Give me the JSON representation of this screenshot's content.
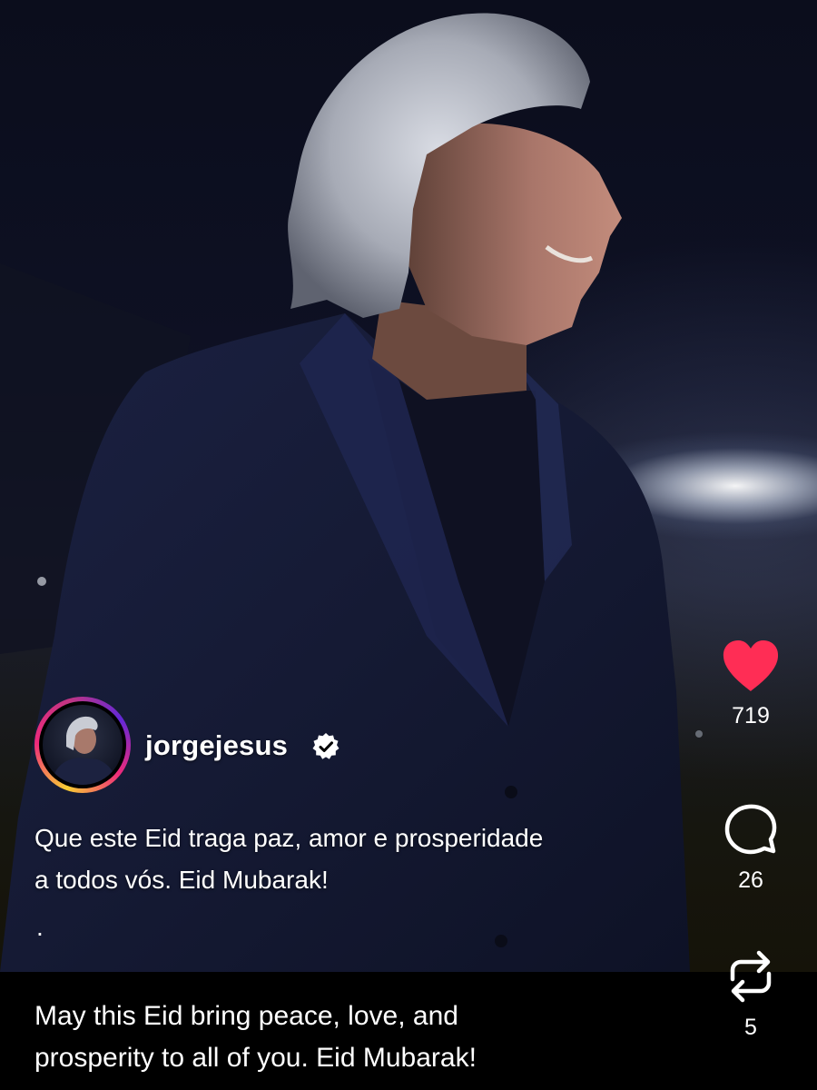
{
  "post": {
    "username": "jorgejesus",
    "caption_line1": "Que este Eid traga paz, amor e prosperidade",
    "caption_line2": "a todos vós. Eid Mubarak!",
    "caption_dot": ".",
    "translation_line1": "May this Eid bring peace, love, and",
    "translation_line2": "prosperity to all of you. Eid Mubarak!"
  },
  "actions": {
    "likes": "719",
    "comments": "26",
    "reposts": "5"
  },
  "colors": {
    "like": "#ff2d55",
    "background": "#000000",
    "text": "#ffffff"
  },
  "icons": [
    "verified-badge-icon",
    "heart-icon",
    "comment-icon",
    "repost-icon"
  ]
}
